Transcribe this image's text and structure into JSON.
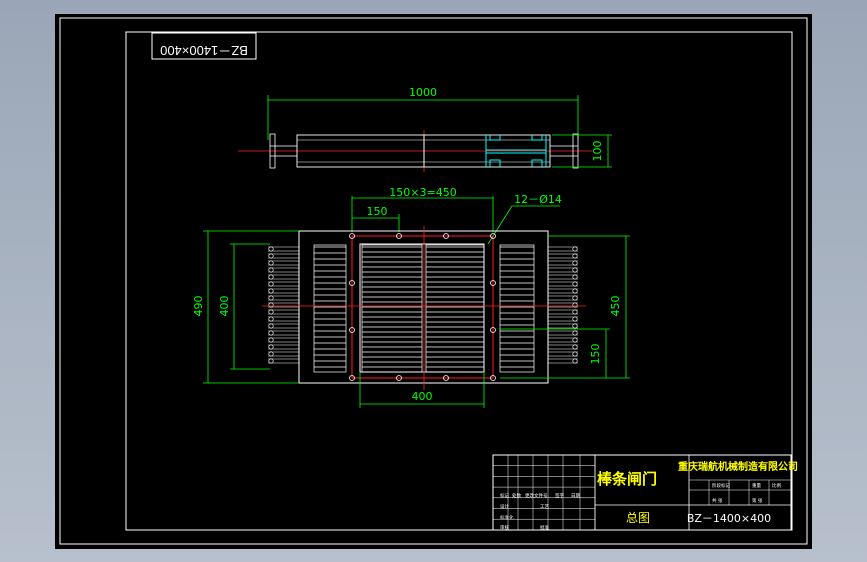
{
  "drawing": {
    "stamp_code_mirrored": "BZ－1400×400",
    "dimensions": {
      "top_width": "1000",
      "top_height": "100",
      "pitch": "150×3=450",
      "pitch_single": "150",
      "holes": "12－Ø14",
      "outer_height": "490",
      "inner_height": "400",
      "right_height": "450",
      "right_small": "150",
      "bottom_width": "400"
    }
  },
  "title_block": {
    "product_name": "棒条闸门",
    "company": "重庆瑞航机械制造有限公司",
    "sheet_type": "总图",
    "drawing_code": "BZ－1400×400",
    "small_labels": [
      "标记",
      "处数",
      "更改文件号",
      "签字",
      "日期",
      "设计",
      "标准化",
      "审核",
      "工艺",
      "批准",
      "阶段标记",
      "重量",
      "比例",
      "共 张",
      "第 张"
    ]
  },
  "colors": {
    "background": "#000000",
    "frame": "#ffffff",
    "dimension": "#00ff00",
    "centerline": "#ff2020",
    "part": "#ffffff",
    "accent": "#00ffff",
    "title_text": "#ffff00"
  }
}
